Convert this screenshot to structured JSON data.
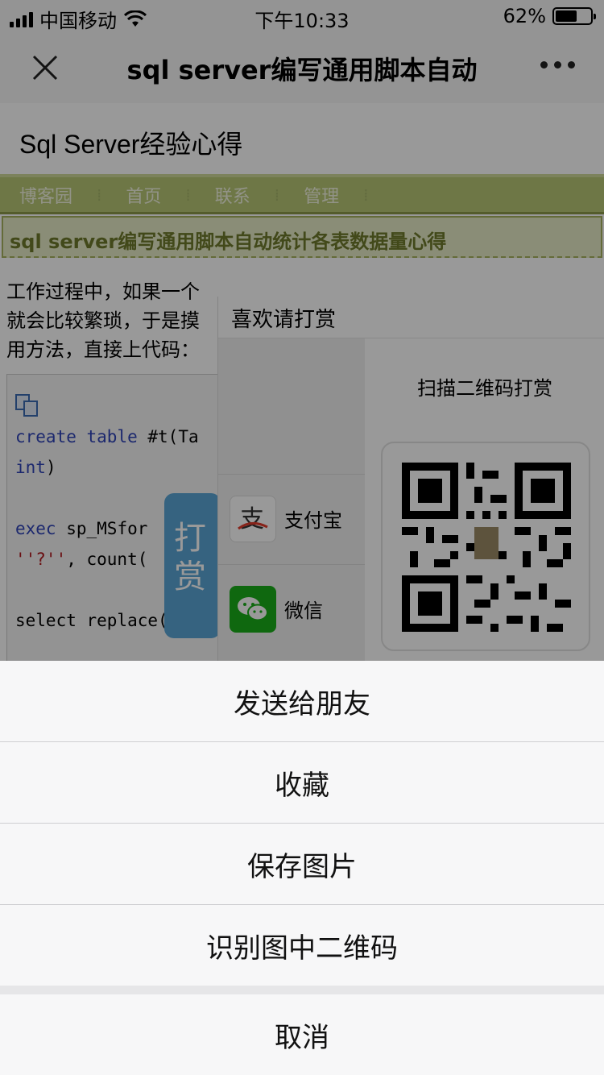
{
  "status_bar": {
    "carrier": "中国移动",
    "time": "下午10:33",
    "battery_percent": "62%",
    "battery_level": 0.62
  },
  "nav": {
    "title": "sql server编写通用脚本自动"
  },
  "page": {
    "site_title": "Sql Server经验心得",
    "menu": [
      "博客园",
      "首页",
      "联系",
      "管理"
    ],
    "post_title": "sql server编写通用脚本自动统计各表数据量心得",
    "body_lines": [
      "工作过程中，如果一个",
      "就会比较繁琐，于是摸",
      "用方法，直接上代码："
    ],
    "code": {
      "line1_kw1": "create",
      "line1_kw2": "table",
      "line1_rest": "#t(Ta",
      "line2_kw": "int",
      "line2_rest": ")",
      "line3_kw": "exec",
      "line3_rest": "sp_MSfor",
      "line4_str": "''?''",
      "line4_rest": ", count(",
      "line5": "select replace(rep"
    },
    "tip_button": [
      "打",
      "赏"
    ]
  },
  "reward": {
    "title": "喜欢请打赏",
    "alipay_label": "支付宝",
    "alipay_icon": "alipay-icon",
    "wechat_label": "微信",
    "wechat_icon": "wechat-icon",
    "qr_caption": "扫描二维码打赏"
  },
  "action_sheet": {
    "send_to_friend": "发送给朋友",
    "favorite": "收藏",
    "save_image": "保存图片",
    "scan_qr": "识别图中二维码",
    "cancel": "取消"
  },
  "colors": {
    "menu_bg": "#b8c776",
    "title_bg": "#e6ecc6",
    "wechat_green": "#1aad19",
    "tip_blue": "#5aa5d6"
  }
}
